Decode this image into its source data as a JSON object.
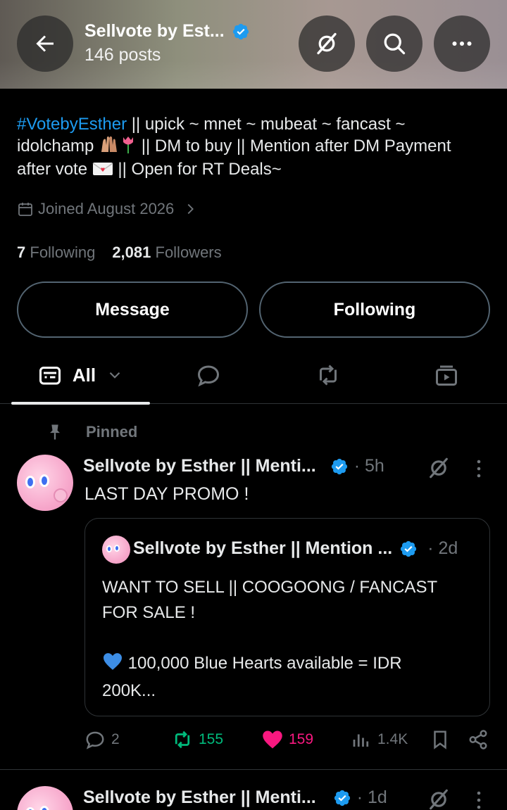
{
  "header": {
    "title": "Sellvote by Est...",
    "post_count": "146 posts"
  },
  "profile": {
    "bio_hashtag": "#VotebyEsther",
    "bio_line1": " || upick ~ mnet ~ mubeat ~ fancast ~",
    "bio_line2a": "idolchamp ",
    "bio_line2b": " || DM to buy || Mention after DM Payment",
    "bio_line3a": "after vote ",
    "bio_line3b": " || Open for RT Deals~",
    "joined": "Joined August 2026",
    "following_count": "7",
    "following_label": "Following",
    "followers_count": "2,081",
    "followers_label": "Followers"
  },
  "buttons": {
    "message": "Message",
    "following": "Following"
  },
  "tabs": {
    "all_label": "All"
  },
  "pinned_post": {
    "pinned_label": "Pinned",
    "author": "Sellvote by Esther || Menti...",
    "time": "· 5h",
    "text": "LAST DAY PROMO !",
    "quote": {
      "author": "Sellvote by Esther || Mention ...",
      "time": "· 2d",
      "line1": "WANT TO SELL || COOGOONG / FANCAST",
      "line2": "FOR SALE !",
      "line3": " 100,000 Blue Hearts available = IDR",
      "line4": "200K..."
    },
    "replies": "2",
    "reposts": "155",
    "likes": "159",
    "views": "1.4K"
  },
  "next_post": {
    "author": "Sellvote by Esther || Menti...",
    "time": "· 1d"
  },
  "colors": {
    "accent": "#1d9bf0",
    "repost": "#00ba7c",
    "like": "#f91880",
    "muted": "#71767b"
  }
}
